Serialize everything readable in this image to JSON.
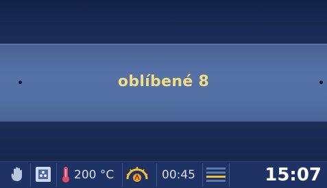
{
  "menu": {
    "selected_label": "oblíbené 8"
  },
  "status_bar": {
    "temperature": "200 °C",
    "timer": "00:45",
    "clock": "15:07"
  },
  "colors": {
    "accent_text": "#f2dc86",
    "bar_background": "#5572a6",
    "screen_background": "#1a2a54"
  },
  "icons": [
    "hand-icon",
    "oven-icon",
    "thermometer-icon",
    "heating-icon",
    "level-icon"
  ]
}
